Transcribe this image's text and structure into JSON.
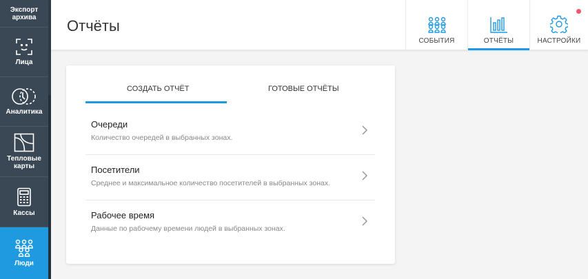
{
  "sidebar": {
    "items": [
      {
        "label": "Экспорт архива",
        "icon": "archive-export-icon"
      },
      {
        "label": "Лица",
        "icon": "face-scan-icon"
      },
      {
        "label": "Аналитика",
        "icon": "analytics-icon"
      },
      {
        "label": "Тепловые карты",
        "icon": "heatmap-icon"
      },
      {
        "label": "Кассы",
        "icon": "cash-register-icon"
      },
      {
        "label": "Люди",
        "icon": "people-icon"
      }
    ]
  },
  "header": {
    "title": "Отчёты",
    "tabs": [
      {
        "label": "СОБЫТИЯ",
        "icon": "people-group-icon"
      },
      {
        "label": "ОТЧЁТЫ",
        "icon": "bar-chart-icon"
      },
      {
        "label": "НАСТРОЙКИ",
        "icon": "gear-icon"
      }
    ]
  },
  "card": {
    "tabs": [
      "СОЗДАТЬ ОТЧЁТ",
      "ГОТОВЫЕ ОТЧЁТЫ"
    ],
    "items": [
      {
        "title": "Очереди",
        "desc": "Количество очередей в выбранных зонах."
      },
      {
        "title": "Посетители",
        "desc": "Среднее и максимальное количество посетителей в выбранных зонах."
      },
      {
        "title": "Рабочее время",
        "desc": "Данные по рабочему времени людей в выбранных зонах."
      }
    ]
  },
  "colors": {
    "accent": "#1e9ae0",
    "sidebar": "#3a4856",
    "notification": "#f0596a"
  }
}
